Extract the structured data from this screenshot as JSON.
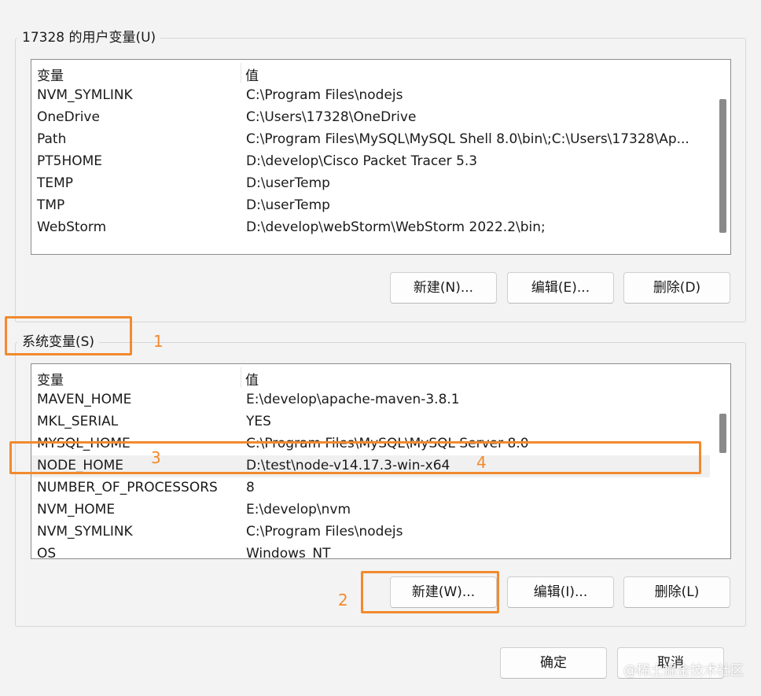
{
  "user_vars": {
    "title": "17328 的用户变量(U)",
    "header": {
      "name": "变量",
      "value": "值"
    },
    "rows": [
      {
        "name": "NVM_SYMLINK",
        "value": "C:\\Program Files\\nodejs"
      },
      {
        "name": "OneDrive",
        "value": "C:\\Users\\17328\\OneDrive"
      },
      {
        "name": "Path",
        "value": "C:\\Program Files\\MySQL\\MySQL Shell 8.0\\bin\\;C:\\Users\\17328\\Ap..."
      },
      {
        "name": "PT5HOME",
        "value": "D:\\develop\\Cisco Packet Tracer 5.3"
      },
      {
        "name": "TEMP",
        "value": "D:\\userTemp"
      },
      {
        "name": "TMP",
        "value": "D:\\userTemp"
      },
      {
        "name": "WebStorm",
        "value": "D:\\develop\\webStorm\\WebStorm 2022.2\\bin;"
      }
    ],
    "buttons": {
      "new": "新建(N)...",
      "edit": "编辑(E)...",
      "delete": "删除(D)"
    }
  },
  "system_vars": {
    "title": "系统变量(S)",
    "header": {
      "name": "变量",
      "value": "值"
    },
    "rows": [
      {
        "name": "MAVEN_HOME",
        "value": "E:\\develop\\apache-maven-3.8.1"
      },
      {
        "name": "MKL_SERIAL",
        "value": "YES"
      },
      {
        "name": "MYSQL_HOME",
        "value": "C:\\Program Files\\MySQL\\MySQL Server 8.0"
      },
      {
        "name": "NODE_HOME",
        "value": "D:\\test\\node-v14.17.3-win-x64"
      },
      {
        "name": "NUMBER_OF_PROCESSORS",
        "value": "8"
      },
      {
        "name": "NVM_HOME",
        "value": "E:\\develop\\nvm"
      },
      {
        "name": "NVM_SYMLINK",
        "value": "C:\\Program Files\\nodejs"
      },
      {
        "name": "OS",
        "value": "Windows_NT"
      }
    ],
    "selected_row": "NODE_HOME",
    "buttons": {
      "new": "新建(W)...",
      "edit": "编辑(I)...",
      "delete": "删除(L)"
    }
  },
  "dialog_buttons": {
    "ok": "确定",
    "cancel": "取消"
  },
  "annotations": {
    "1": "1",
    "2": "2",
    "3": "3",
    "4": "4",
    "color": "#f28a2e"
  },
  "watermark": "@稀土掘金技术社区"
}
